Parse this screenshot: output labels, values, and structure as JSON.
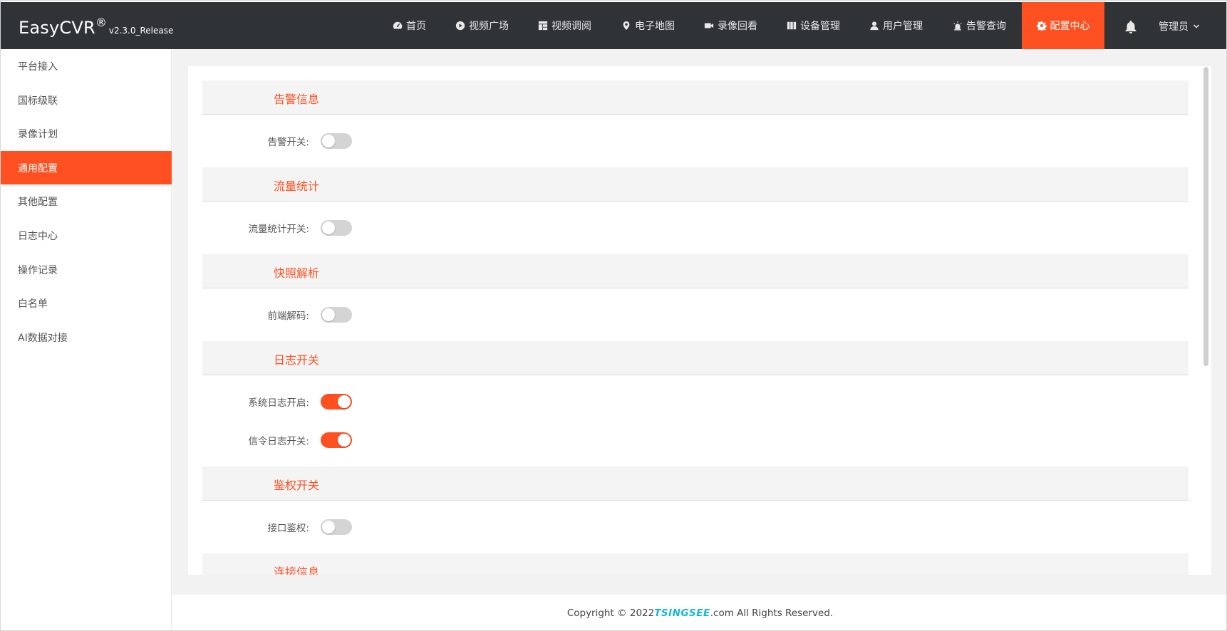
{
  "app": {
    "brand": "EasyCVR",
    "reg": "®",
    "version": "v2.3.0_Release"
  },
  "nav": [
    {
      "label": "首页",
      "icon": "dashboard-icon"
    },
    {
      "label": "视频广场",
      "icon": "play-circle-icon"
    },
    {
      "label": "视频调阅",
      "icon": "grid-layout-icon"
    },
    {
      "label": "电子地图",
      "icon": "map-pin-icon"
    },
    {
      "label": "录像回看",
      "icon": "video-camera-icon"
    },
    {
      "label": "设备管理",
      "icon": "columns-icon"
    },
    {
      "label": "用户管理",
      "icon": "user-icon"
    },
    {
      "label": "告警查询",
      "icon": "alarm-icon"
    },
    {
      "label": "配置中心",
      "icon": "gear-icon",
      "active": true
    }
  ],
  "user": {
    "name": "管理员"
  },
  "sidebar": {
    "items": [
      {
        "label": "平台接入"
      },
      {
        "label": "国标级联"
      },
      {
        "label": "录像计划"
      },
      {
        "label": "通用配置",
        "active": true
      },
      {
        "label": "其他配置"
      },
      {
        "label": "日志中心"
      },
      {
        "label": "操作记录"
      },
      {
        "label": "白名单"
      },
      {
        "label": "AI数据对接"
      }
    ]
  },
  "sections": [
    {
      "title": "告警信息",
      "rows": [
        {
          "label": "告警开关:",
          "on": false
        }
      ]
    },
    {
      "title": "流量统计",
      "rows": [
        {
          "label": "流量统计开关:",
          "on": false
        }
      ]
    },
    {
      "title": "快照解析",
      "rows": [
        {
          "label": "前端解码:",
          "on": false
        }
      ]
    },
    {
      "title": "日志开关",
      "rows": [
        {
          "label": "系统日志开启:",
          "on": true
        },
        {
          "label": "信令日志开关:",
          "on": true
        }
      ]
    },
    {
      "title": "鉴权开关",
      "rows": [
        {
          "label": "接口鉴权:",
          "on": false
        }
      ]
    },
    {
      "title": "连接信息",
      "rows": []
    }
  ],
  "footer": {
    "prefix": "Copyright © 2022 ",
    "brand": "TSINGSEE",
    "suffix": ".com All Rights Reserved."
  },
  "colors": {
    "accent": "#ff5022",
    "topbar": "#303336"
  }
}
